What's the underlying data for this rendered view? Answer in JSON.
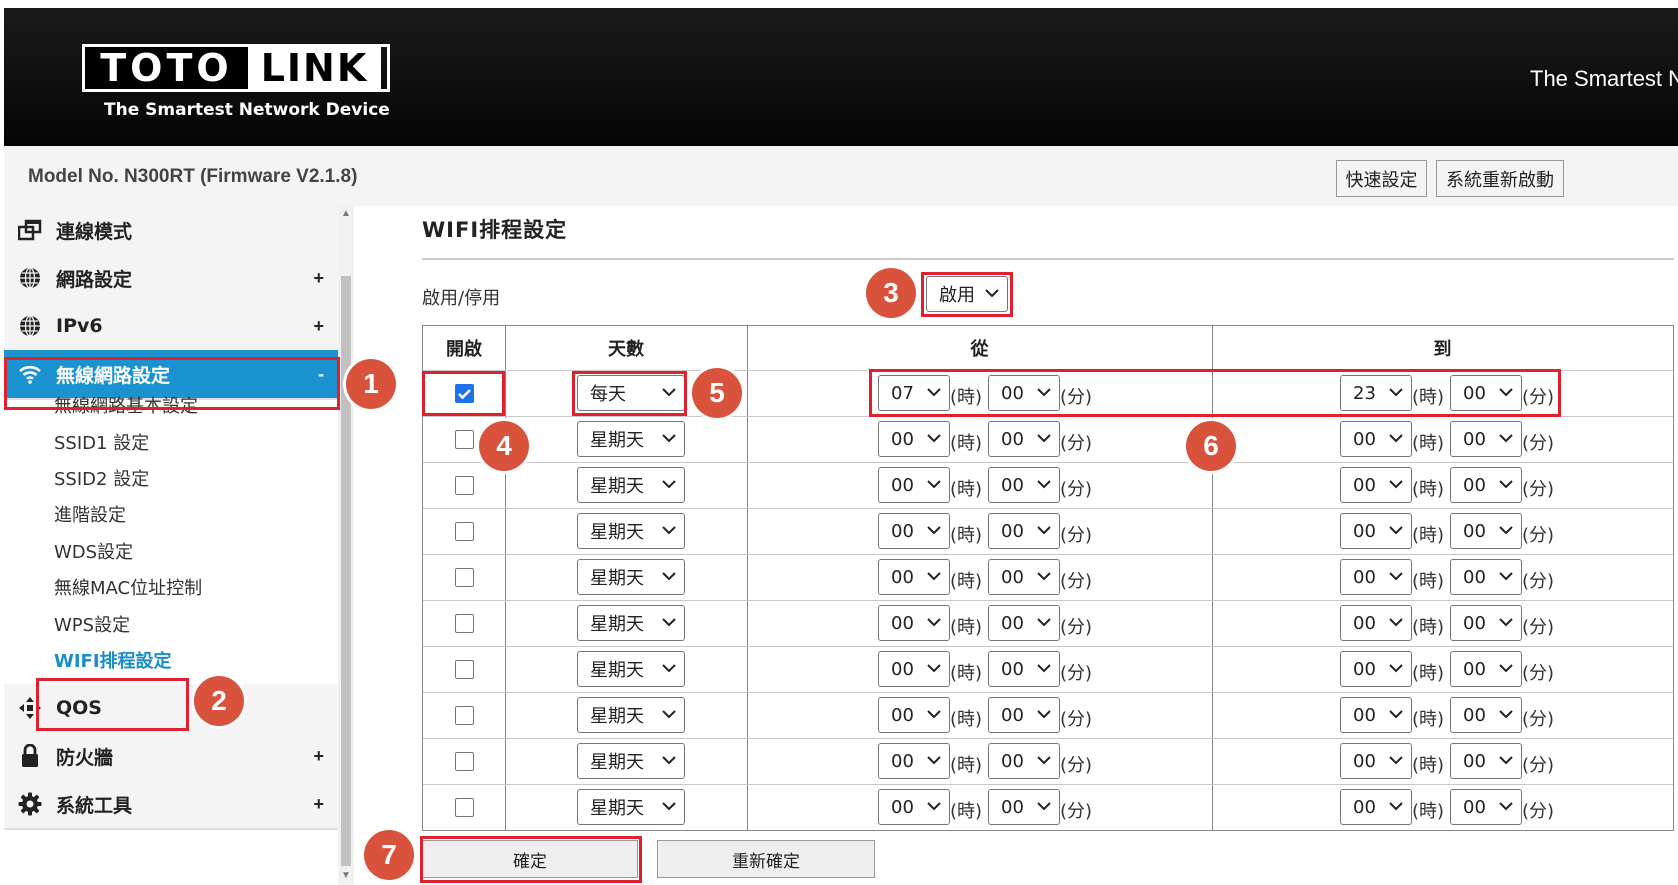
{
  "header": {
    "logo_left": "TOTO",
    "logo_right": "LINK",
    "logo_tagline": "The Smartest Network Device",
    "slogan": "The Smartest N"
  },
  "modelbar": {
    "model": "Model No. N300RT (Firmware V2.1.8)",
    "quick_setup": "快速設定",
    "reboot": "系統重新啟動"
  },
  "sidebar": {
    "items": [
      {
        "label": "連線模式",
        "icon": "window-icon",
        "expand": ""
      },
      {
        "label": "網路設定",
        "icon": "globe-icon",
        "expand": "+"
      },
      {
        "label": "IPv6",
        "icon": "globe-icon",
        "expand": "+"
      },
      {
        "label": "無線網路設定",
        "icon": "wifi-icon",
        "expand": "-"
      },
      {
        "label": "QOS",
        "icon": "qos-icon",
        "expand": ""
      },
      {
        "label": "防火牆",
        "icon": "lock-icon",
        "expand": "+"
      },
      {
        "label": "系統工具",
        "icon": "gear-icon",
        "expand": "+"
      }
    ],
    "subitems": [
      "無線網路基本設定",
      "SSID1 設定",
      "SSID2 設定",
      "進階設定",
      "WDS設定",
      "無線MAC位址控制",
      "WPS設定",
      "WIFI排程設定"
    ]
  },
  "main": {
    "title": "WIFI排程設定",
    "enable_label": "啟用/停用",
    "enable_value": "啟用",
    "columns": [
      "開啟",
      "天數",
      "從",
      "到"
    ],
    "hour_unit": "(時)",
    "minute_unit": "(分)",
    "rows": [
      {
        "checked": true,
        "day": "每天",
        "from_h": "07",
        "from_m": "00",
        "to_h": "23",
        "to_m": "00"
      },
      {
        "checked": false,
        "day": "星期天",
        "from_h": "00",
        "from_m": "00",
        "to_h": "00",
        "to_m": "00"
      },
      {
        "checked": false,
        "day": "星期天",
        "from_h": "00",
        "from_m": "00",
        "to_h": "00",
        "to_m": "00"
      },
      {
        "checked": false,
        "day": "星期天",
        "from_h": "00",
        "from_m": "00",
        "to_h": "00",
        "to_m": "00"
      },
      {
        "checked": false,
        "day": "星期天",
        "from_h": "00",
        "from_m": "00",
        "to_h": "00",
        "to_m": "00"
      },
      {
        "checked": false,
        "day": "星期天",
        "from_h": "00",
        "from_m": "00",
        "to_h": "00",
        "to_m": "00"
      },
      {
        "checked": false,
        "day": "星期天",
        "from_h": "00",
        "from_m": "00",
        "to_h": "00",
        "to_m": "00"
      },
      {
        "checked": false,
        "day": "星期天",
        "from_h": "00",
        "from_m": "00",
        "to_h": "00",
        "to_m": "00"
      },
      {
        "checked": false,
        "day": "星期天",
        "from_h": "00",
        "from_m": "00",
        "to_h": "00",
        "to_m": "00"
      },
      {
        "checked": false,
        "day": "星期天",
        "from_h": "00",
        "from_m": "00",
        "to_h": "00",
        "to_m": "00"
      }
    ],
    "confirm": "確定",
    "reset": "重新確定"
  },
  "annotations": [
    "1",
    "2",
    "3",
    "4",
    "5",
    "6",
    "7"
  ],
  "colors": {
    "accent": "#1a93d0",
    "highlight": "#e0202c",
    "badge": "#d9533c"
  }
}
